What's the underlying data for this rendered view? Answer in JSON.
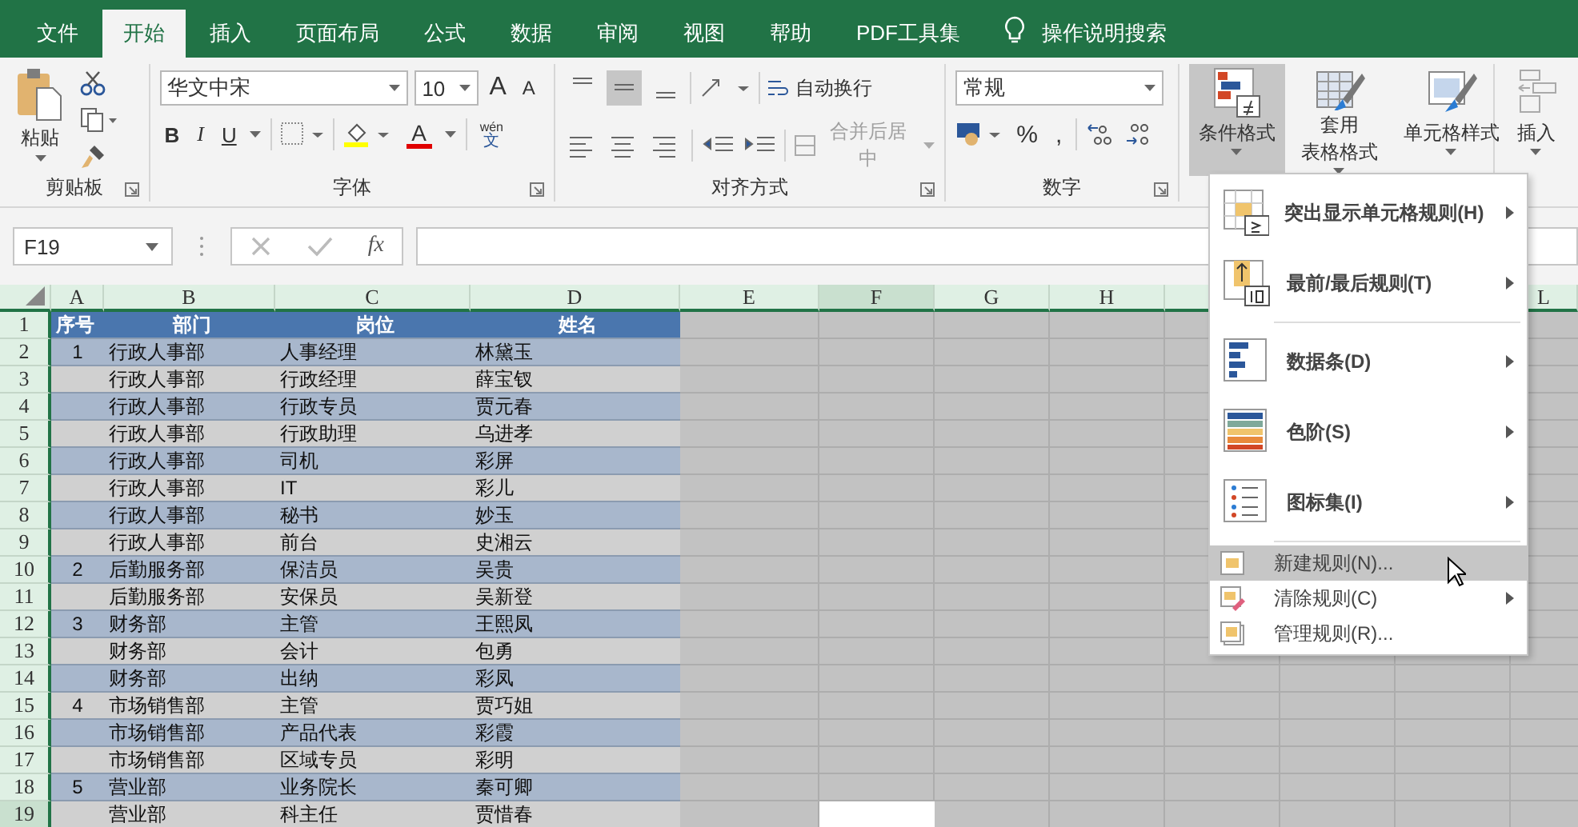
{
  "tabs": [
    {
      "label": "文件",
      "selected": false
    },
    {
      "label": "开始",
      "selected": true
    },
    {
      "label": "插入",
      "selected": false
    },
    {
      "label": "页面布局",
      "selected": false
    },
    {
      "label": "公式",
      "selected": false
    },
    {
      "label": "数据",
      "selected": false
    },
    {
      "label": "审阅",
      "selected": false
    },
    {
      "label": "视图",
      "selected": false
    },
    {
      "label": "帮助",
      "selected": false
    },
    {
      "label": "PDF工具集",
      "selected": false
    }
  ],
  "tell_me": "操作说明搜索",
  "ribbon": {
    "clipboard": {
      "paste": "粘贴",
      "group": "剪贴板"
    },
    "font": {
      "name": "华文中宋",
      "size": "10",
      "grow": "A",
      "shrink": "A",
      "styles": [
        "B",
        "I",
        "U"
      ],
      "color_letter": "A",
      "phonetic_top": "wén",
      "phonetic_bottom": "文",
      "group": "字体"
    },
    "alignment": {
      "vertical": [
        {
          "selected": false
        },
        {
          "selected": true
        },
        {
          "selected": false
        }
      ],
      "wrap": "自动换行",
      "merge": "合并后居中",
      "merge_disabled": true,
      "group": "对齐方式"
    },
    "number": {
      "format": "常规",
      "percent": "%",
      "comma": ",",
      "group": "数字"
    },
    "styles": [
      {
        "lines": [
          "条件格式"
        ],
        "selected": true
      },
      {
        "lines": [
          "套用",
          "表格格式"
        ],
        "selected": false
      },
      {
        "lines": [
          "单元格样式"
        ],
        "selected": false
      }
    ],
    "cells": {
      "insert": "插入"
    }
  },
  "formula_bar": {
    "name_box": "F19",
    "fx": "fx"
  },
  "sheet": {
    "columns": [
      {
        "label": "A",
        "selected": false
      },
      {
        "label": "B",
        "selected": false
      },
      {
        "label": "C",
        "selected": false
      },
      {
        "label": "D",
        "selected": false
      },
      {
        "label": "E",
        "selected": false
      },
      {
        "label": "F",
        "selected": true
      },
      {
        "label": "G",
        "selected": false
      },
      {
        "label": "H",
        "selected": false
      },
      {
        "label": "L",
        "selected": false
      }
    ],
    "rows": [
      {
        "number": "1",
        "kind": "header",
        "selected": false,
        "cells": [
          "序号",
          "部门",
          "岗位",
          "姓名"
        ]
      },
      {
        "number": "2",
        "kind": "data",
        "selected": false,
        "cells": [
          "1",
          "行政人事部",
          "人事经理",
          "林黛玉"
        ]
      },
      {
        "number": "3",
        "kind": "data",
        "selected": false,
        "cells": [
          "",
          "行政人事部",
          "行政经理",
          "薛宝钗"
        ]
      },
      {
        "number": "4",
        "kind": "data",
        "selected": false,
        "cells": [
          "",
          "行政人事部",
          "行政专员",
          "贾元春"
        ]
      },
      {
        "number": "5",
        "kind": "data",
        "selected": false,
        "cells": [
          "",
          "行政人事部",
          "行政助理",
          "乌进孝"
        ]
      },
      {
        "number": "6",
        "kind": "data",
        "selected": false,
        "cells": [
          "",
          "行政人事部",
          "司机",
          "彩屏"
        ]
      },
      {
        "number": "7",
        "kind": "data",
        "selected": false,
        "cells": [
          "",
          "行政人事部",
          "IT",
          "彩儿"
        ]
      },
      {
        "number": "8",
        "kind": "data",
        "selected": false,
        "cells": [
          "",
          "行政人事部",
          "秘书",
          "妙玉"
        ]
      },
      {
        "number": "9",
        "kind": "data",
        "selected": false,
        "cells": [
          "",
          "行政人事部",
          "前台",
          "史湘云"
        ]
      },
      {
        "number": "10",
        "kind": "data",
        "selected": false,
        "cells": [
          "2",
          "后勤服务部",
          "保洁员",
          "吴贵"
        ]
      },
      {
        "number": "11",
        "kind": "data",
        "selected": false,
        "cells": [
          "",
          "后勤服务部",
          "安保员",
          "吴新登"
        ]
      },
      {
        "number": "12",
        "kind": "data",
        "selected": false,
        "cells": [
          "3",
          "财务部",
          "主管",
          "王熙凤"
        ]
      },
      {
        "number": "13",
        "kind": "data",
        "selected": false,
        "cells": [
          "",
          "财务部",
          "会计",
          "包勇"
        ]
      },
      {
        "number": "14",
        "kind": "data",
        "selected": false,
        "cells": [
          "",
          "财务部",
          "出纳",
          "彩凤"
        ]
      },
      {
        "number": "15",
        "kind": "data",
        "selected": false,
        "cells": [
          "4",
          "市场销售部",
          "主管",
          "贾巧姐"
        ]
      },
      {
        "number": "16",
        "kind": "data",
        "selected": false,
        "cells": [
          "",
          "市场销售部",
          "产品代表",
          "彩霞"
        ]
      },
      {
        "number": "17",
        "kind": "data",
        "selected": false,
        "cells": [
          "",
          "市场销售部",
          "区域专员",
          "彩明"
        ]
      },
      {
        "number": "18",
        "kind": "data",
        "selected": false,
        "cells": [
          "5",
          "营业部",
          "业务院长",
          "秦可卿"
        ]
      },
      {
        "number": "19",
        "kind": "data",
        "selected": true,
        "cells": [
          "",
          "营业部",
          "科主任",
          "贾惜春"
        ]
      }
    ]
  },
  "menu": [
    {
      "label": "突出显示单元格规则(H)",
      "kind": "large",
      "submenu": true,
      "divider_before": false,
      "selected": false
    },
    {
      "label": "最前/最后规则(T)",
      "kind": "large",
      "submenu": true,
      "divider_before": false,
      "selected": false
    },
    {
      "label": "数据条(D)",
      "kind": "large",
      "submenu": true,
      "divider_before": true,
      "selected": false
    },
    {
      "label": "色阶(S)",
      "kind": "large",
      "submenu": true,
      "divider_before": false,
      "selected": false
    },
    {
      "label": "图标集(I)",
      "kind": "large",
      "submenu": true,
      "divider_before": false,
      "selected": false
    },
    {
      "label": "新建规则(N)...",
      "kind": "small",
      "submenu": false,
      "divider_before": true,
      "selected": true
    },
    {
      "label": "清除规则(C)",
      "kind": "small",
      "submenu": true,
      "divider_before": false,
      "selected": false
    },
    {
      "label": "管理规则(R)...",
      "kind": "small",
      "submenu": false,
      "divider_before": false,
      "selected": false
    }
  ]
}
